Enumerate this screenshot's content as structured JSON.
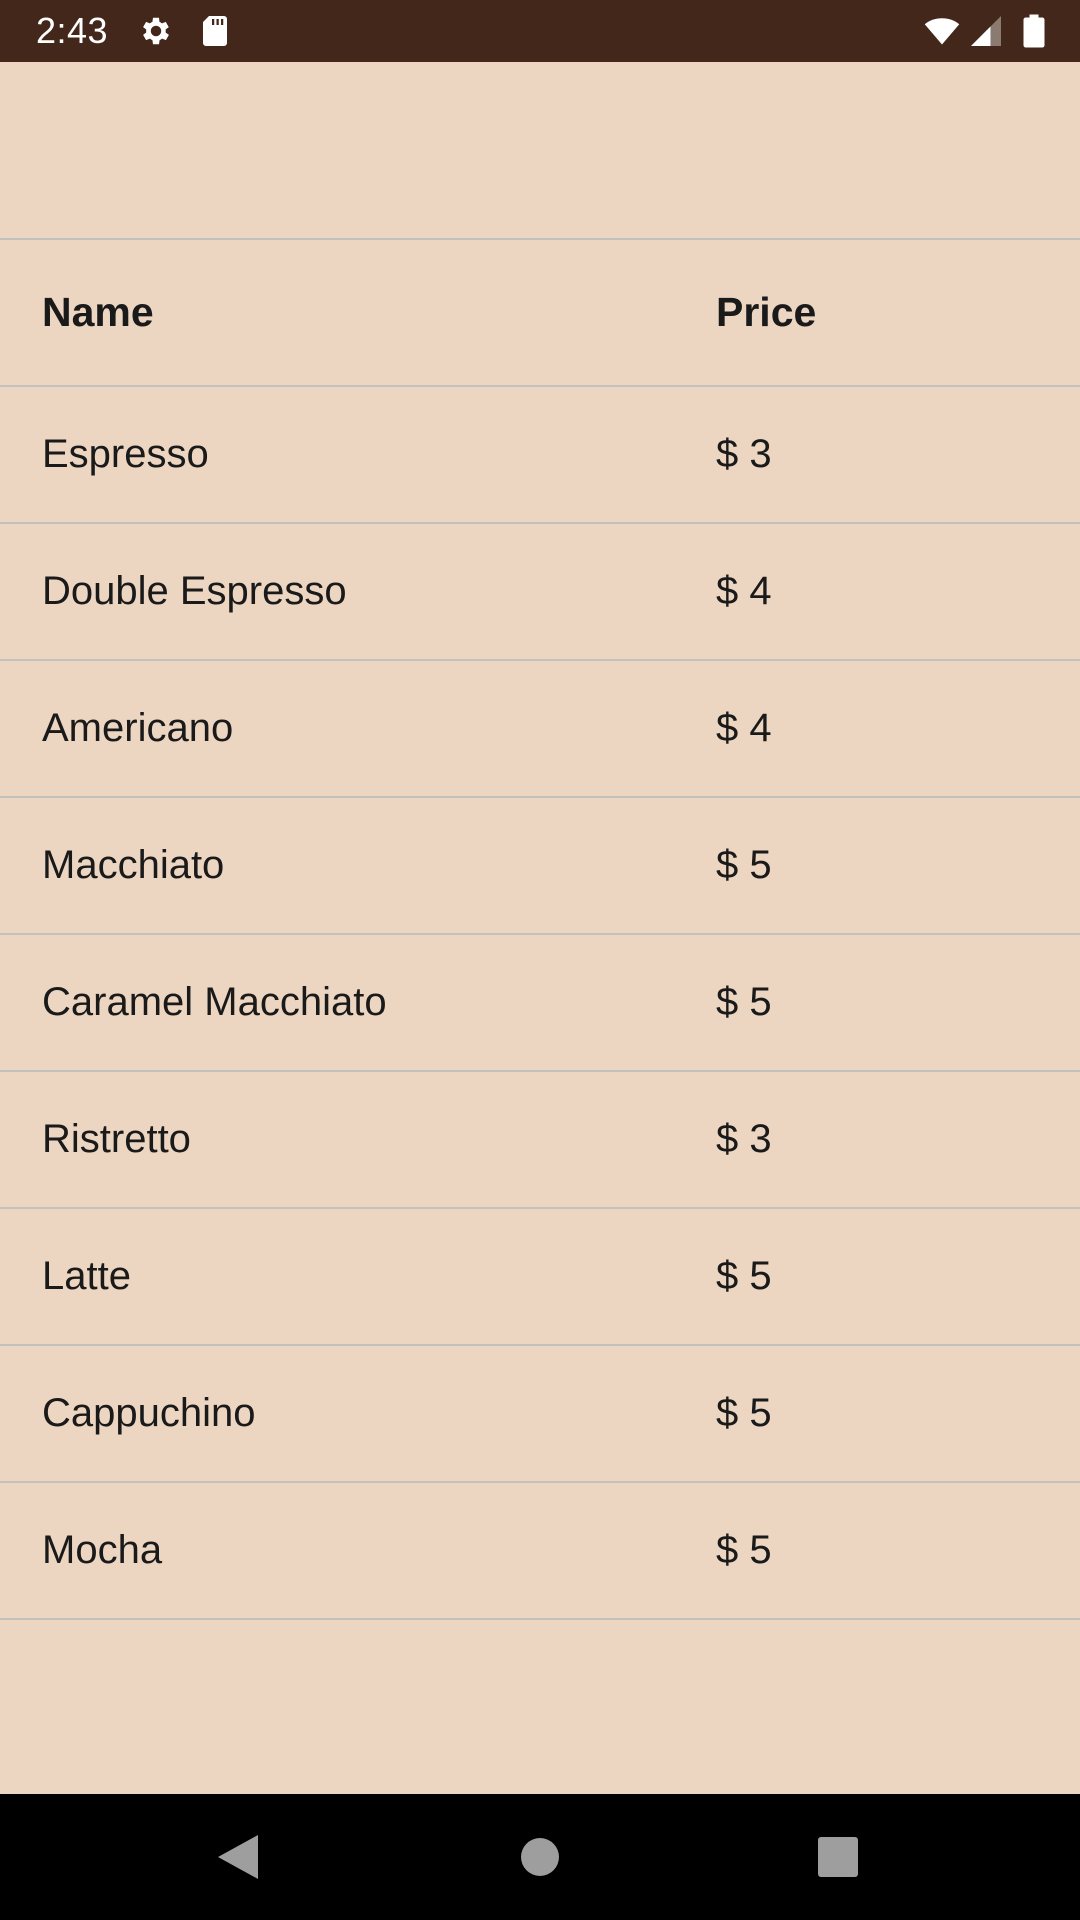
{
  "status_bar": {
    "time": "2:43",
    "icons": [
      "gear-icon",
      "sd-card-icon",
      "wifi-icon",
      "cell-signal-icon",
      "battery-icon"
    ],
    "background": "#43271a"
  },
  "theme": {
    "page_background": "#edd6c1",
    "divider": "#c3c1bd",
    "text": "#1a1a1a"
  },
  "table": {
    "headers": {
      "name": "Name",
      "price": "Price"
    },
    "rows": [
      {
        "name": "Espresso",
        "price": "$ 3"
      },
      {
        "name": "Double Espresso",
        "price": "$ 4"
      },
      {
        "name": "Americano",
        "price": "$ 4"
      },
      {
        "name": "Macchiato",
        "price": "$ 5"
      },
      {
        "name": "Caramel Macchiato",
        "price": "$ 5"
      },
      {
        "name": "Ristretto",
        "price": "$ 3"
      },
      {
        "name": "Latte",
        "price": "$ 5"
      },
      {
        "name": "Cappuchino",
        "price": "$ 5"
      },
      {
        "name": "Mocha",
        "price": "$ 5"
      }
    ]
  },
  "nav_bar": {
    "buttons": [
      "back-icon",
      "home-icon",
      "recents-icon"
    ]
  }
}
